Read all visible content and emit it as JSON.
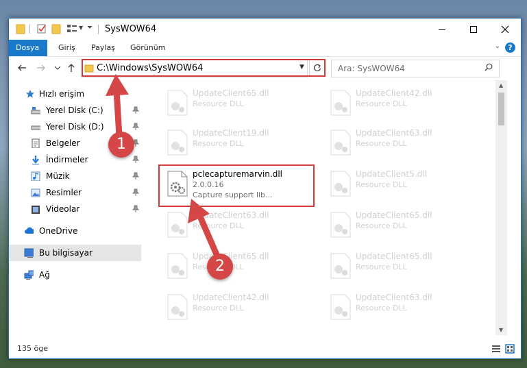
{
  "window": {
    "title": "SysWOW64"
  },
  "ribbon": {
    "tabs": [
      {
        "label": "Dosya"
      },
      {
        "label": "Giriş"
      },
      {
        "label": "Paylaş"
      },
      {
        "label": "Görünüm"
      }
    ],
    "help": "?"
  },
  "address": {
    "path": "C:\\Windows\\SysWOW64",
    "search_placeholder": "Ara: SysWOW64"
  },
  "nav": {
    "items": [
      {
        "label": "Hızlı erişim",
        "icon": "star-icon"
      },
      {
        "label": "Yerel Disk (C:)",
        "icon": "drive-icon"
      },
      {
        "label": "Yerel Disk (D:)",
        "icon": "drive-icon"
      },
      {
        "label": "Belgeler",
        "icon": "documents-icon"
      },
      {
        "label": "İndirmeler",
        "icon": "download-icon"
      },
      {
        "label": "Müzik",
        "icon": "music-icon"
      },
      {
        "label": "Resimler",
        "icon": "pictures-icon"
      },
      {
        "label": "Videolar",
        "icon": "videos-icon"
      },
      {
        "label": "OneDrive",
        "icon": "cloud-icon"
      },
      {
        "label": "Bu bilgisayar",
        "icon": "computer-icon"
      },
      {
        "label": "Ağ",
        "icon": "network-icon"
      }
    ]
  },
  "files": [
    {
      "name": "UpdateClient65.dll",
      "desc": "Resource DLL"
    },
    {
      "name": "UpdateClient42.dll",
      "desc": "Resource DLL"
    },
    {
      "name": "UpdateClient19.dll",
      "desc": "Resource DLL"
    },
    {
      "name": "UpdateClient63.dll",
      "desc": "Resource DLL"
    },
    {
      "name": "pclecapturemarvin.dll",
      "version": "2.0.0.16",
      "desc": "Capture support lib..."
    },
    {
      "name": "UpdateClient5.dll",
      "desc": "Resource DLL"
    },
    {
      "name": "UpdateClient63.dll",
      "desc": "Resource DLL"
    },
    {
      "name": "UpdateClient65.dll",
      "desc": "Resource DLL"
    },
    {
      "name": "UpdateClient65.dll",
      "desc": "Resource DLL"
    },
    {
      "name": "UpdateClient65.dll",
      "desc": "Resource DLL"
    },
    {
      "name": "UpdateClient42.dll",
      "desc": "Resource DLL"
    },
    {
      "name": "UpdateClient63.dll",
      "desc": "Resource DLL"
    }
  ],
  "status": {
    "count": "135 öge"
  },
  "badges": {
    "one": "1",
    "two": "2"
  },
  "colors": {
    "accent": "#1979ca",
    "highlight": "#d63b3b",
    "badge": "#d54646"
  }
}
